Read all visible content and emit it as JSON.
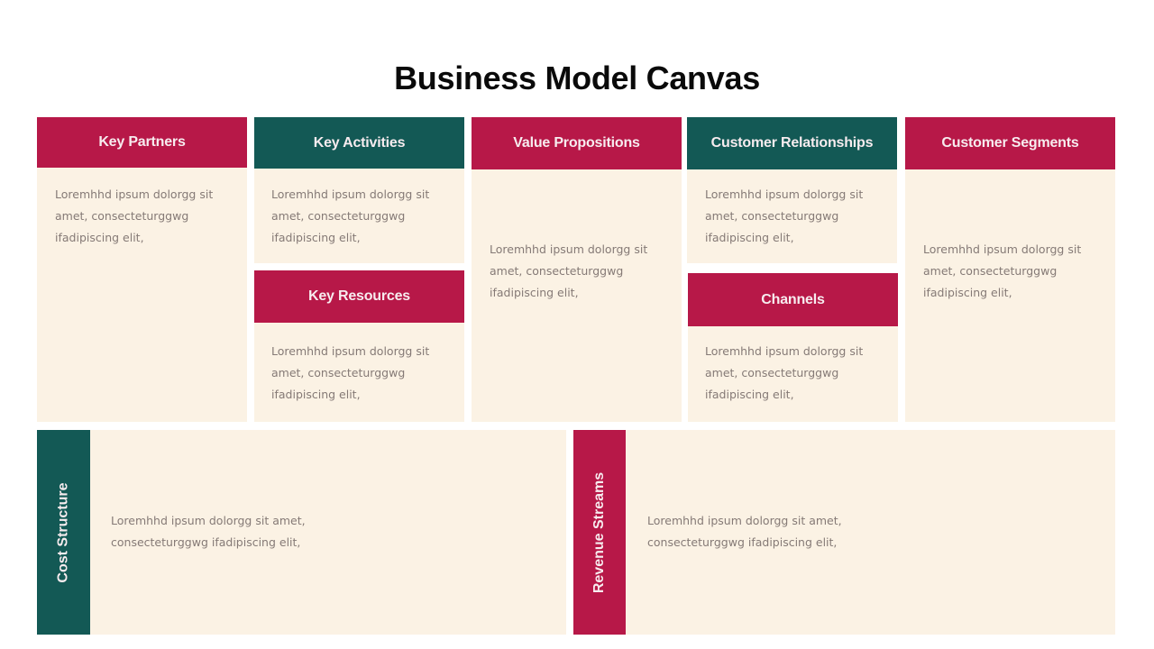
{
  "title": "Business Model Canvas",
  "colors": {
    "red": "#b71848",
    "green": "#135955",
    "panel": "#fbf2e4",
    "body_text": "#857a76"
  },
  "blocks": {
    "key_partners": {
      "label": "Key Partners",
      "text": [
        "Loremhhd ipsum dolorgg sit",
        "amet, consecteturggwg",
        "ifadipiscing elit,"
      ]
    },
    "key_activities": {
      "label": "Key Activities",
      "text": [
        "Loremhhd ipsum dolorgg sit",
        "amet, consecteturggwg",
        "ifadipiscing elit,"
      ]
    },
    "key_resources": {
      "label": "Key Resources",
      "text": [
        "Loremhhd ipsum dolorgg sit",
        "amet, consecteturggwg",
        "ifadipiscing elit,"
      ]
    },
    "value_propositions": {
      "label": "Value Propositions",
      "text": [
        "Loremhhd ipsum dolorgg sit",
        "amet, consecteturggwg",
        "ifadipiscing elit,"
      ]
    },
    "customer_relationships": {
      "label": "Customer Relationships",
      "text": [
        "Loremhhd ipsum dolorgg sit",
        "amet, consecteturggwg",
        "ifadipiscing elit,"
      ]
    },
    "channels": {
      "label": "Channels",
      "text": [
        "Loremhhd ipsum dolorgg sit",
        "amet, consecteturggwg",
        "ifadipiscing elit,"
      ]
    },
    "customer_segments": {
      "label": "Customer Segments",
      "text": [
        "Loremhhd ipsum dolorgg sit",
        "amet, consecteturggwg",
        "ifadipiscing elit,"
      ]
    },
    "cost_structure": {
      "label": "Cost Structure",
      "text": [
        "Loremhhd ipsum dolorgg sit amet,",
        "consecteturggwg ifadipiscing elit,"
      ]
    },
    "revenue_streams": {
      "label": "Revenue Streams",
      "text": [
        "Loremhhd ipsum dolorgg sit amet,",
        "consecteturggwg ifadipiscing elit,"
      ]
    }
  }
}
